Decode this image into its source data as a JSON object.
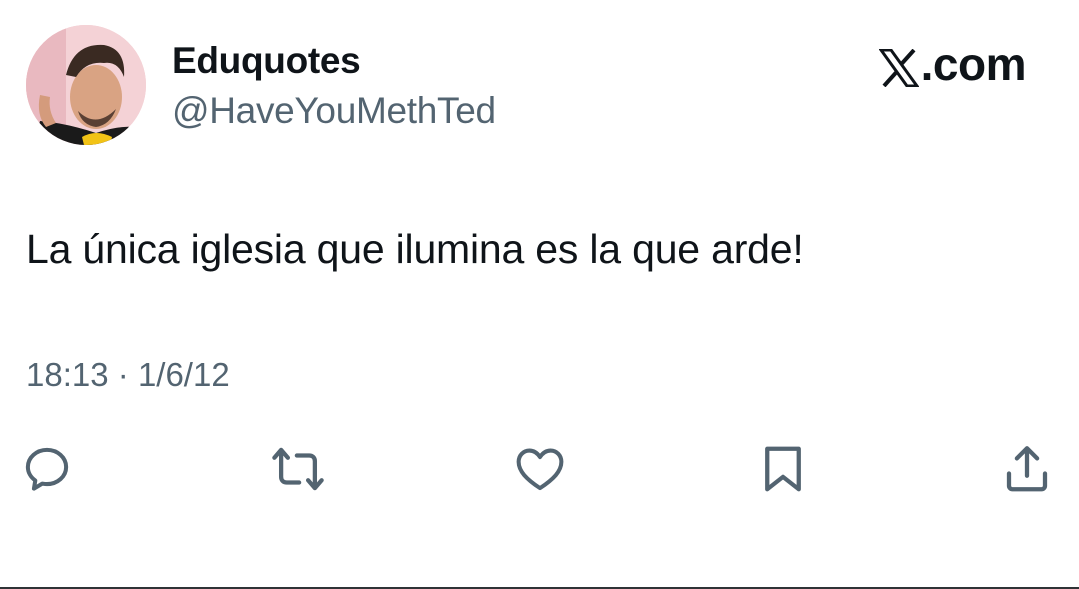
{
  "author": {
    "display_name": "Eduquotes",
    "handle": "@HaveYouMethTed",
    "avatar": "profile-photo"
  },
  "brand": {
    "logo_icon": "x-logo-icon",
    "suffix": ".com"
  },
  "tweet": {
    "text": "La única iglesia que ilumina es la que arde!",
    "time": "18:13",
    "separator": "·",
    "date": "1/6/12"
  },
  "actions": [
    {
      "icon": "reply-icon"
    },
    {
      "icon": "retweet-icon"
    },
    {
      "icon": "like-icon"
    },
    {
      "icon": "bookmark-icon"
    },
    {
      "icon": "share-icon"
    }
  ],
  "colors": {
    "text_primary": "#0f1419",
    "text_secondary": "#536471",
    "background": "#ffffff"
  }
}
